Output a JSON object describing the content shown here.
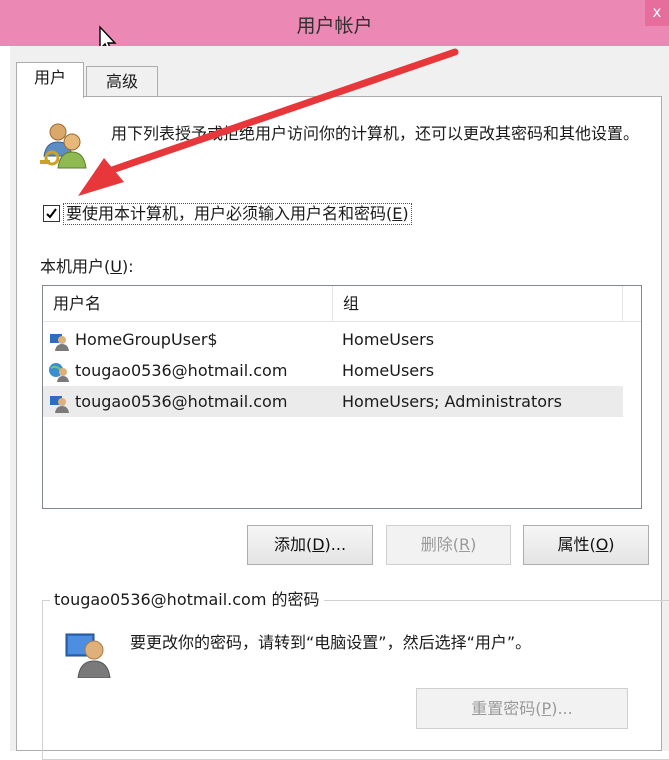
{
  "window": {
    "title": "用户帐户",
    "close_glyph": "x"
  },
  "tabs": [
    {
      "label": "用户",
      "active": true
    },
    {
      "label": "高级",
      "active": false
    }
  ],
  "intro": {
    "text": "用下列表授予或拒绝用户访问你的计算机，还可以更改其密码和其他设置。",
    "icon": "users-icon"
  },
  "require_login": {
    "checked": true,
    "label_pre": "要使用本计算机，用户必须输入用户名和密码(",
    "label_key": "E",
    "label_post": ")"
  },
  "local_users": {
    "label_pre": "本机用户(",
    "label_key": "U",
    "label_post": "):"
  },
  "table": {
    "columns": [
      "用户名",
      "组"
    ],
    "rows": [
      {
        "name": "HomeGroupUser$",
        "group": "HomeUsers",
        "icon": "user-icon",
        "selected": false
      },
      {
        "name": "tougao0536@hotmail.com",
        "group": "HomeUsers",
        "icon": "globe-user-icon",
        "selected": false
      },
      {
        "name": "tougao0536@hotmail.com",
        "group": "HomeUsers; Administrators",
        "icon": "user-icon",
        "selected": true
      }
    ]
  },
  "buttons": {
    "add": {
      "pre": "添加(",
      "key": "D",
      "post": ")...",
      "enabled": true
    },
    "remove": {
      "pre": "删除(",
      "key": "R",
      "post": ")",
      "enabled": false
    },
    "properties": {
      "pre": "属性(",
      "key": "O",
      "post": ")",
      "enabled": true
    }
  },
  "password_group": {
    "title": "tougao0536@hotmail.com 的密码",
    "text": "要更改你的密码，请转到“电脑设置”，然后选择“用户”。",
    "reset": {
      "pre": "重置密码(",
      "key": "P",
      "post": ")...",
      "enabled": false
    }
  },
  "colors": {
    "titlebar": "#ec88b4",
    "annotation_arrow": "#e8373a"
  }
}
